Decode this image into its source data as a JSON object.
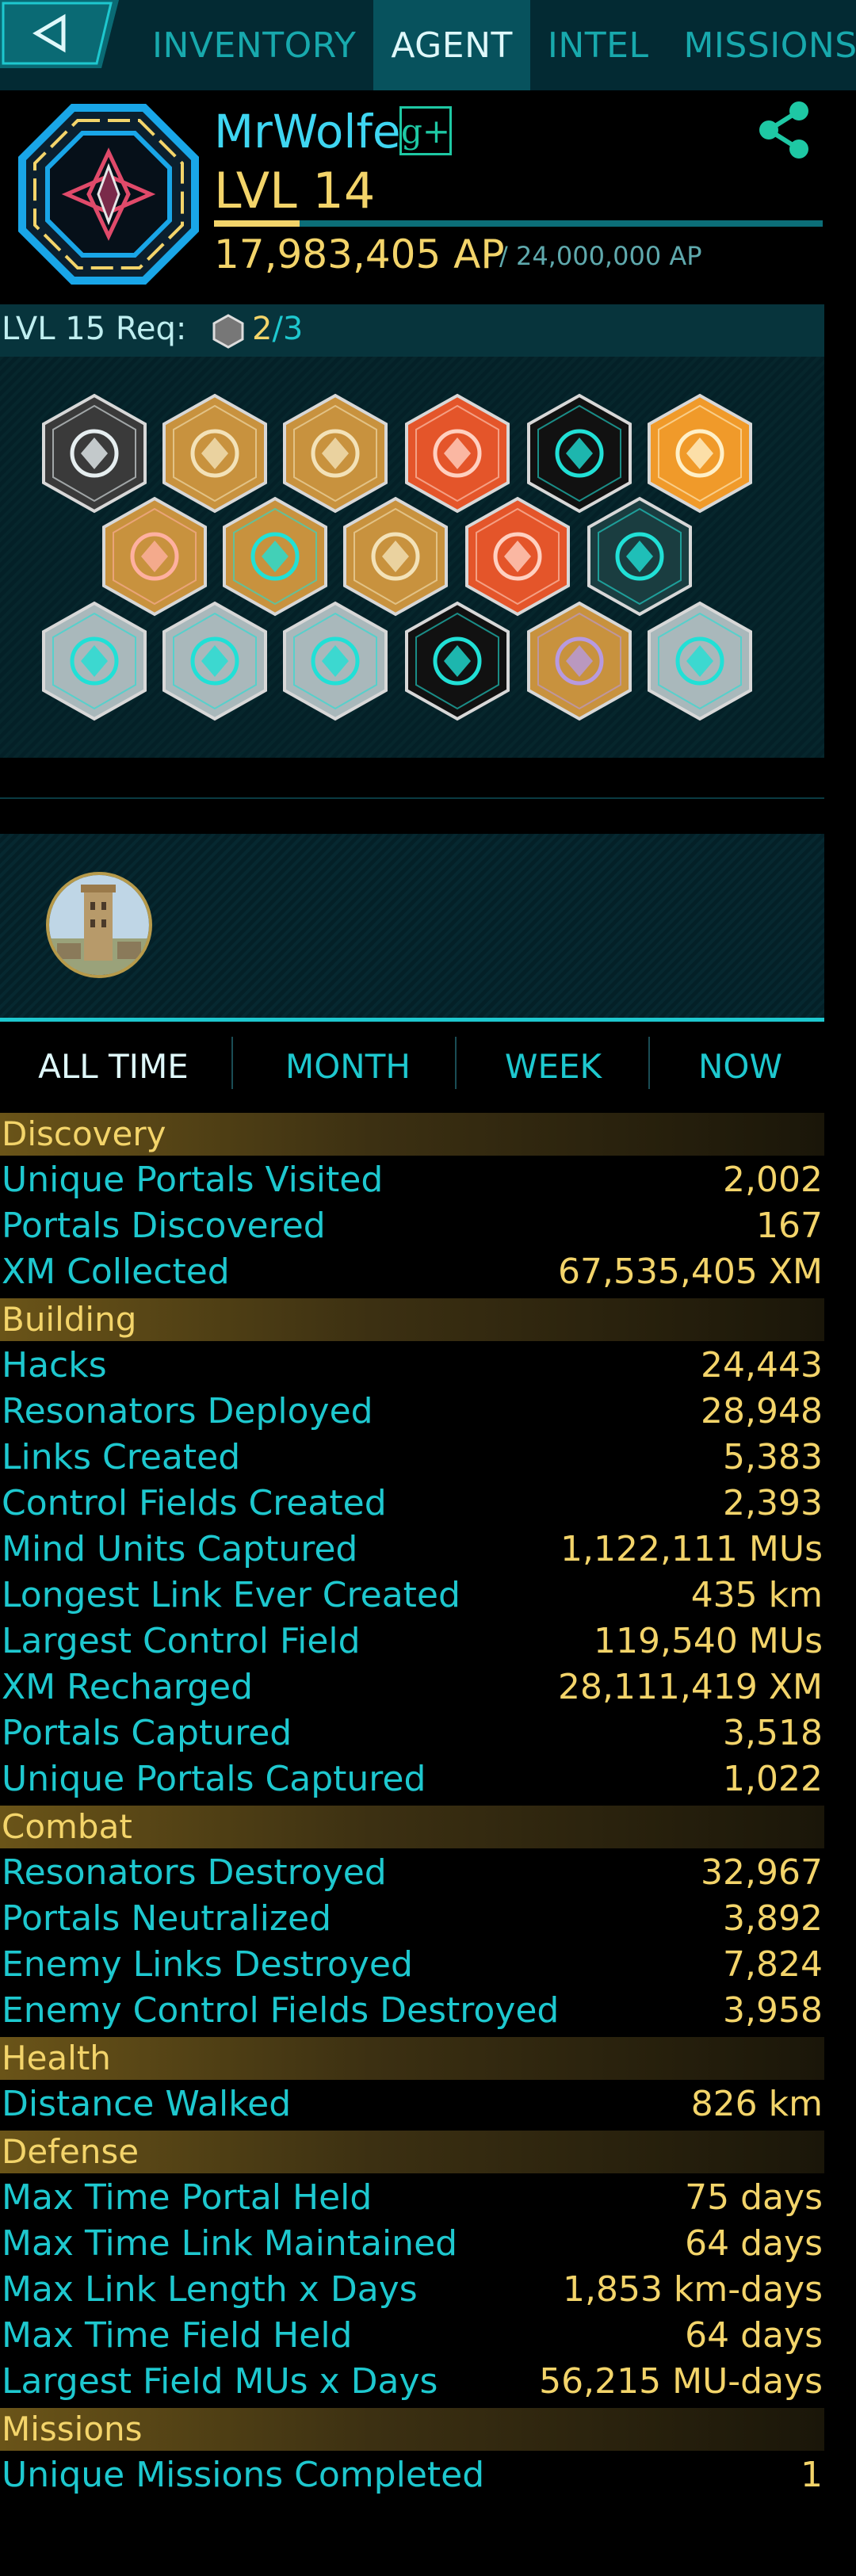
{
  "nav": {
    "tabs": [
      {
        "label": "INVENTORY"
      },
      {
        "label": "AGENT"
      },
      {
        "label": "INTEL"
      },
      {
        "label": "MISSIONS"
      }
    ],
    "active_tab": "AGENT"
  },
  "agent": {
    "name": "MrWolfe",
    "gplus_label": "g+",
    "level": "LVL 14",
    "ap": "17,983,405 AP",
    "ap_total": "/ 24,000,000 AP",
    "level_progress": 0.14
  },
  "requirement": {
    "label": "LVL 15 Req:",
    "count": "2",
    "total": "/3"
  },
  "badges": [
    {
      "name": "badge-pioneer-icon",
      "color": "#3a3a3a"
    },
    {
      "name": "badge-explorer-icon",
      "color": "#c8923e"
    },
    {
      "name": "badge-hacker-icon",
      "color": "#c8923e"
    },
    {
      "name": "badge-darsana-icon",
      "color": "#e4552a"
    },
    {
      "name": "badge-shonin-icon",
      "color": "#111111"
    },
    {
      "name": "badge-helios-icon",
      "color": "#f09a2a"
    },
    {
      "name": "badge-purifier-icon",
      "color": "#c8923e"
    },
    {
      "name": "badge-connector-icon",
      "color": "#c8923e"
    },
    {
      "name": "badge-mind-controller-icon",
      "color": "#c8923e"
    },
    {
      "name": "badge-obsidian-icon",
      "color": "#e4552a"
    },
    {
      "name": "badge-verified-icon",
      "color": "#1a3d40"
    },
    {
      "name": "badge-seer-icon",
      "color": "#a9b8bb"
    },
    {
      "name": "badge-builder-icon",
      "color": "#a9b8bb"
    },
    {
      "name": "badge-guardian-icon",
      "color": "#a9b8bb"
    },
    {
      "name": "badge-vitruvian-icon",
      "color": "#111111"
    },
    {
      "name": "badge-recharger-icon",
      "color": "#c8923e"
    },
    {
      "name": "badge-observer-icon",
      "color": "#a9b8bb"
    }
  ],
  "time_tabs": [
    "ALL TIME",
    "MONTH",
    "WEEK",
    "NOW"
  ],
  "stats": [
    {
      "section": "Discovery",
      "rows": [
        {
          "name": "Unique Portals Visited",
          "value": "2,002"
        },
        {
          "name": "Portals Discovered",
          "value": "167"
        },
        {
          "name": "XM Collected",
          "value": "67,535,405 XM"
        }
      ]
    },
    {
      "section": "Building",
      "rows": [
        {
          "name": "Hacks",
          "value": "24,443"
        },
        {
          "name": "Resonators Deployed",
          "value": "28,948"
        },
        {
          "name": "Links Created",
          "value": "5,383"
        },
        {
          "name": "Control Fields Created",
          "value": "2,393"
        },
        {
          "name": "Mind Units Captured",
          "value": "1,122,111 MUs"
        },
        {
          "name": "Longest Link Ever Created",
          "value": "435 km"
        },
        {
          "name": "Largest Control Field",
          "value": "119,540 MUs"
        },
        {
          "name": "XM Recharged",
          "value": "28,111,419 XM"
        },
        {
          "name": "Portals Captured",
          "value": "3,518"
        },
        {
          "name": "Unique Portals Captured",
          "value": "1,022"
        }
      ]
    },
    {
      "section": "Combat",
      "rows": [
        {
          "name": "Resonators Destroyed",
          "value": "32,967"
        },
        {
          "name": "Portals Neutralized",
          "value": "3,892"
        },
        {
          "name": "Enemy Links Destroyed",
          "value": "7,824"
        },
        {
          "name": "Enemy Control Fields Destroyed",
          "value": "3,958"
        }
      ]
    },
    {
      "section": "Health",
      "rows": [
        {
          "name": "Distance Walked",
          "value": "826 km"
        }
      ]
    },
    {
      "section": "Defense",
      "rows": [
        {
          "name": "Max Time Portal Held",
          "value": "75 days"
        },
        {
          "name": "Max Time Link Maintained",
          "value": "64 days"
        },
        {
          "name": "Max Link Length x Days",
          "value": "1,853 km-days"
        },
        {
          "name": "Max Time Field Held",
          "value": "64 days"
        },
        {
          "name": "Largest Field MUs x Days",
          "value": "56,215 MU-days"
        }
      ]
    },
    {
      "section": "Missions",
      "rows": [
        {
          "name": "Unique Missions Completed",
          "value": "1"
        }
      ]
    }
  ]
}
